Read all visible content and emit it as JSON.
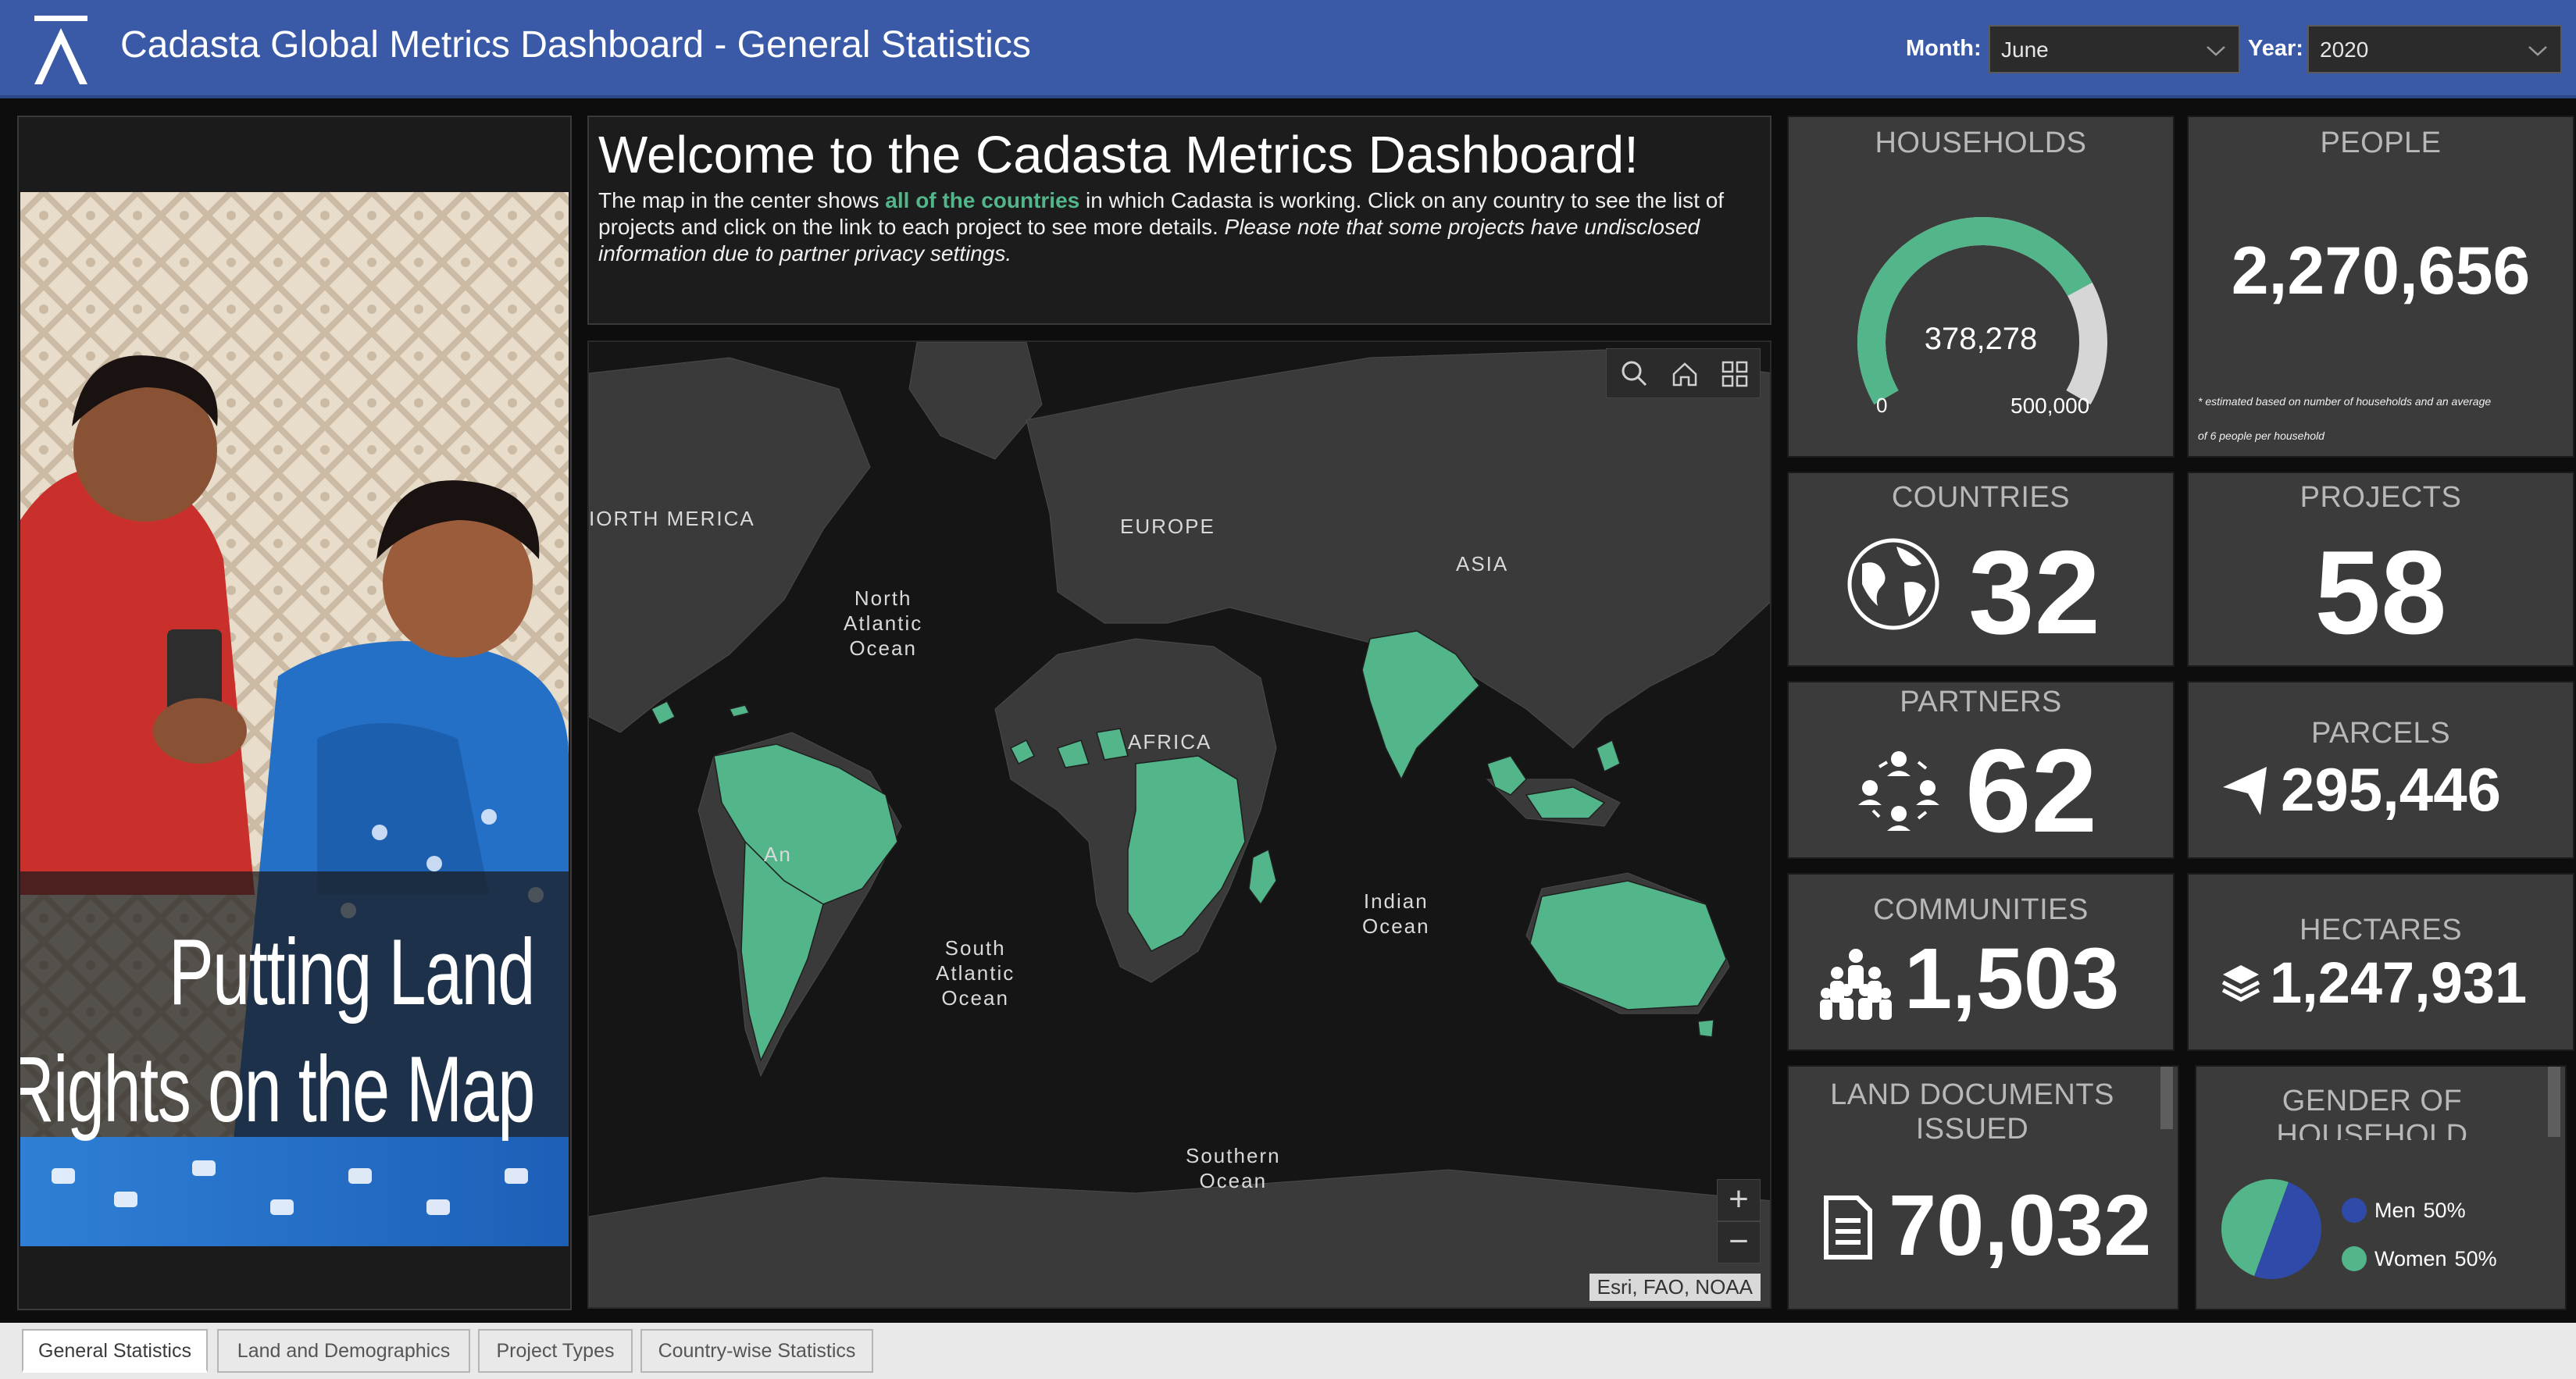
{
  "header": {
    "title": "Cadasta Global Metrics Dashboard - General Statistics",
    "month_label": "Month:",
    "month_value": "June",
    "year_label": "Year:",
    "year_value": "2020"
  },
  "promo": {
    "line1": "Putting Land",
    "line2": "Rights on the Map"
  },
  "welcome": {
    "title": "Welcome to the Cadasta Metrics Dashboard!",
    "text_before": "The map in the center shows ",
    "text_highlight": "all of the countries",
    "text_after": " in which Cadasta is working. Click on any country to see the list of projects and click on the link to each project to see more details. ",
    "text_italic": "Please note that some projects have undisclosed information due to partner privacy settings."
  },
  "map": {
    "labels": {
      "north_america": "IORTH\nMERICA",
      "europe": "EUROPE",
      "asia": "ASIA",
      "africa": "AFRICA",
      "north_atlantic": "North\nAtlantic\nOcean",
      "south_atlantic": "South\nAtlantic\nOcean",
      "indian": "Indian\nOcean",
      "southern": "Southern\nOcean",
      "south_america_fragment": "An"
    },
    "zoom_in": "+",
    "zoom_out": "−",
    "attribution": "Esri, FAO, NOAA",
    "tool_icons": [
      "search-icon",
      "home-icon",
      "qr-basemap-icon"
    ]
  },
  "metrics": {
    "households": {
      "title": "HOUSEHOLDS",
      "value": "378,278",
      "min": "0",
      "max": "500,000",
      "fraction": 0.7566
    },
    "people": {
      "title": "PEOPLE",
      "value": "2,270,656",
      "note_line1": "* estimated based on number of households and an average",
      "note_line2": "of 6 people per household"
    },
    "countries": {
      "title": "COUNTRIES",
      "value": "32",
      "icon": "globe-icon"
    },
    "projects": {
      "title": "PROJECTS",
      "value": "58"
    },
    "partners": {
      "title": "PARTNERS",
      "value": "62",
      "icon": "partners-network-icon"
    },
    "parcels": {
      "title": "PARCELS",
      "value": "295,446",
      "icon": "parcel-flag-icon"
    },
    "communities": {
      "title": "COMMUNITIES",
      "value": "1,503",
      "icon": "community-people-icon"
    },
    "hectares": {
      "title": "HECTARES",
      "value": "1,247,931",
      "icon": "layers-icon"
    },
    "land_documents": {
      "title_line1": "LAND DOCUMENTS",
      "title_line2": "ISSUED",
      "value": "70,032",
      "icon": "document-icon"
    },
    "gender": {
      "title_line1": "GENDER OF",
      "title_line2": "HOUSEHOLD",
      "legend": [
        {
          "label": "Men",
          "value": "50%",
          "color": "#2f4aa8"
        },
        {
          "label": "Women",
          "value": "50%",
          "color": "#53b58a"
        }
      ]
    }
  },
  "colors": {
    "accent_green": "#53b58a",
    "header_blue": "#3a5aa8",
    "tile_gray": "#3b3b3b"
  },
  "tabs": [
    {
      "label": "General Statistics",
      "active": true
    },
    {
      "label": "Land and Demographics",
      "active": false
    },
    {
      "label": "Project Types",
      "active": false
    },
    {
      "label": "Country-wise Statistics",
      "active": false
    }
  ]
}
